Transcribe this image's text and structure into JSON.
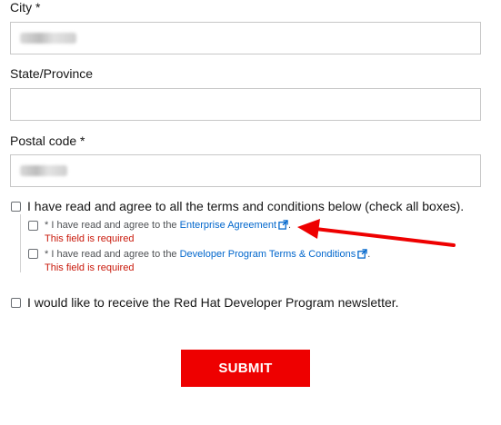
{
  "city": {
    "label": "City *",
    "value": ""
  },
  "state": {
    "label": "State/Province",
    "value": ""
  },
  "postal": {
    "label": "Postal code *",
    "value": ""
  },
  "terms": {
    "label": "I have read and agree to all the terms and conditions below (check all boxes).",
    "items": [
      {
        "prefix": "* I have read and agree to the ",
        "link": "Enterprise Agreement",
        "suffix": ".",
        "error": "This field is required"
      },
      {
        "prefix": "* I have read and agree to the ",
        "link": "Developer Program Terms & Conditions",
        "suffix": ".",
        "error": "This field is required"
      }
    ]
  },
  "newsletter": {
    "label": "I would like to receive the Red Hat Developer Program newsletter."
  },
  "submit": {
    "label": "SUBMIT"
  },
  "colors": {
    "accent": "#ee0000",
    "link": "#0066cc",
    "error": "#c9190b",
    "arrow": "#ee0000"
  }
}
